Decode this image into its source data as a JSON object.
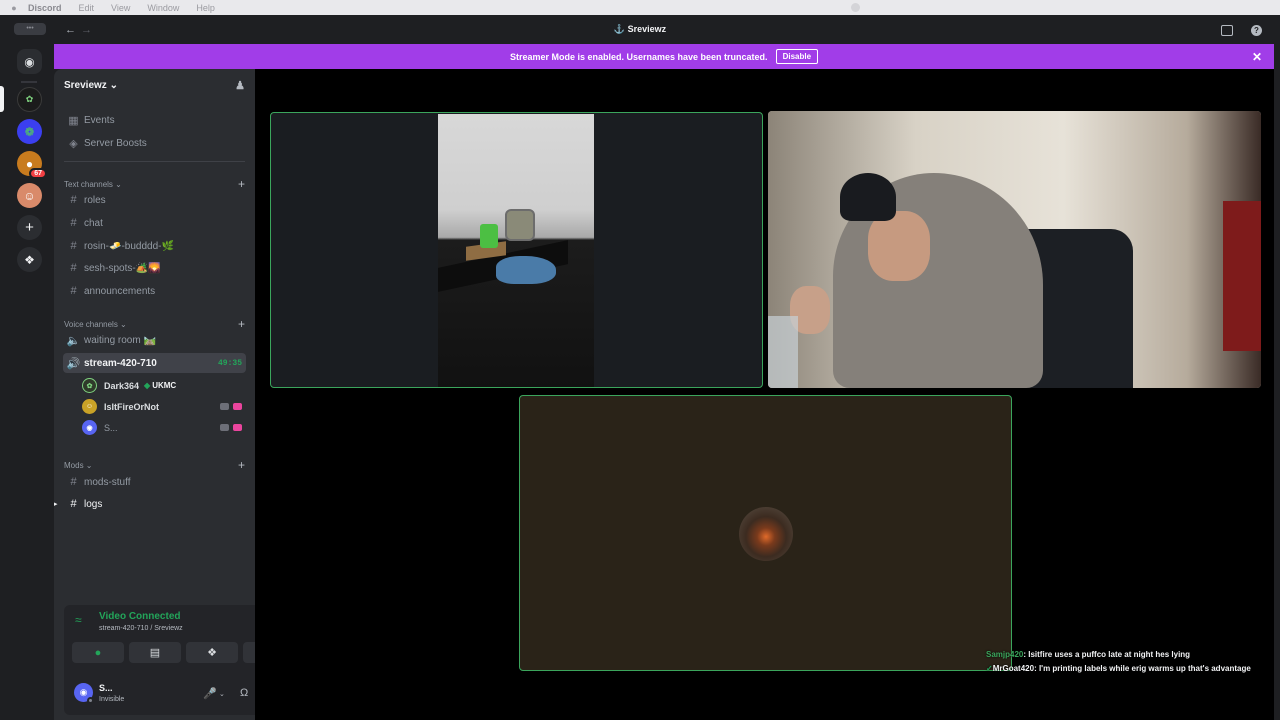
{
  "menubar": {
    "app": "Discord",
    "items": [
      "Edit",
      "View",
      "Window",
      "Help"
    ]
  },
  "titlebar": {
    "title": "Sreviewz"
  },
  "banner": {
    "text": "Streamer Mode is enabled. Usernames have been truncated.",
    "button": "Disable"
  },
  "guilds": {
    "badge": "67"
  },
  "server": {
    "name": "Sreviewz",
    "top_items": [
      {
        "icon": "calendar-icon",
        "label": "Events"
      },
      {
        "icon": "boost-icon",
        "label": "Server Boosts"
      }
    ],
    "text_section": "Text channels",
    "text_channels": [
      "roles",
      "chat",
      "rosin-🧈-budddd-🌿",
      "sesh-spots-🏕️🌄",
      "announcements"
    ],
    "voice_section": "Voice channels",
    "voice_channels": [
      {
        "label": "waiting room 🛤️"
      },
      {
        "label": "stream-420-710",
        "timer": "49:35"
      }
    ],
    "voice_users": [
      {
        "name": "Dark364",
        "tag": "UKMC",
        "avatar_color": "#2f3a2a"
      },
      {
        "name": "IsItFireOrNot",
        "avatar_color": "#c9a227"
      },
      {
        "name": "S...",
        "avatar_color": "#5865f2"
      }
    ],
    "mods_section": "Mods",
    "mods_channels": [
      "mods-stuff",
      "logs"
    ]
  },
  "voice_panel": {
    "status": "Video Connected",
    "channel": "stream-420-710 / Sreviewz"
  },
  "user": {
    "name": "S...",
    "status": "Invisible"
  },
  "chat_overlay": [
    {
      "user": "Samjp420",
      "text": "Isitfire uses a puffco late at night hes lying"
    },
    {
      "user": "MrGoat420",
      "text": "I'm printing labels while erig warms up that's advantage"
    }
  ],
  "colors": {
    "accent": "#a13de8",
    "connected": "#23a55a",
    "blurple": "#5865f2"
  }
}
